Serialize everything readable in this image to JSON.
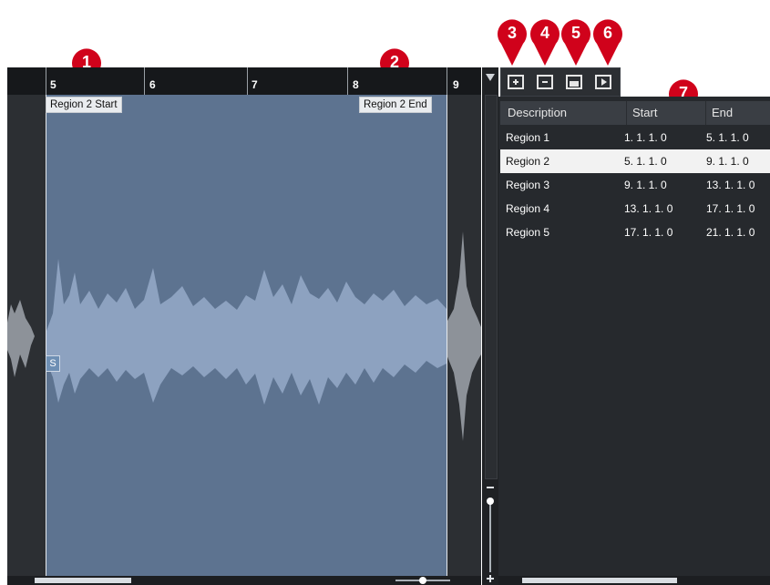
{
  "callouts": [
    "1",
    "2",
    "3",
    "4",
    "5",
    "6",
    "7"
  ],
  "ruler": {
    "bars": [
      "5",
      "6",
      "7",
      "8",
      "9"
    ]
  },
  "region_tags": {
    "start": "Region 2 Start",
    "end": "Region 2 End"
  },
  "snap_label": "S",
  "toolbar": {
    "buttons": [
      "add-region-icon",
      "remove-region-icon",
      "set-region-icon",
      "play-region-icon"
    ]
  },
  "table": {
    "headers": [
      "Description",
      "Start",
      "End"
    ],
    "rows": [
      {
        "description": "Region 1",
        "start": "1. 1. 1.  0",
        "end": "5. 1. 1.  0"
      },
      {
        "description": "Region 2",
        "start": "5. 1. 1.  0",
        "end": "9. 1. 1.  0"
      },
      {
        "description": "Region 3",
        "start": "9. 1. 1.  0",
        "end": "13. 1. 1.  0"
      },
      {
        "description": "Region 4",
        "start": "13. 1. 1.  0",
        "end": "17. 1. 1.  0"
      },
      {
        "description": "Region 5",
        "start": "17. 1. 1.  0",
        "end": "21. 1. 1.  0"
      }
    ],
    "selected_row": 2
  },
  "colors": {
    "callout": "#d0021b",
    "region": "#5d7390",
    "waveform": "#8da2c0"
  }
}
